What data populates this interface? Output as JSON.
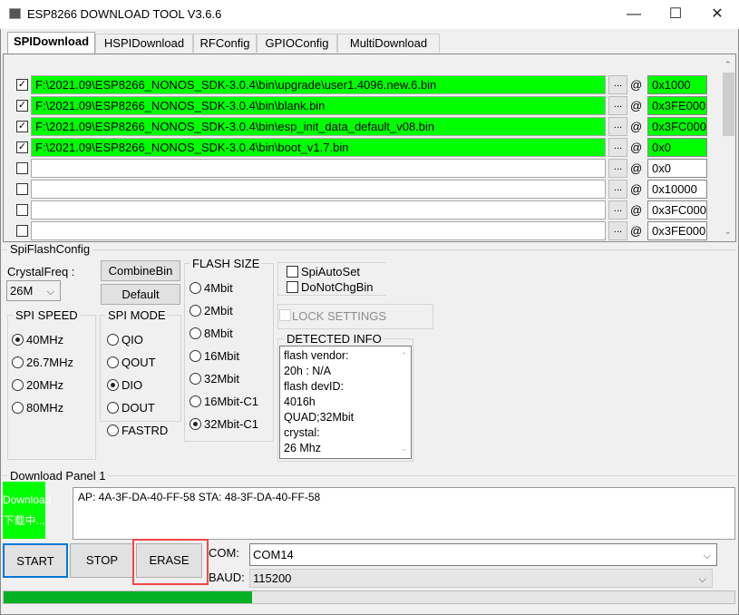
{
  "window": {
    "title": "ESP8266 DOWNLOAD TOOL V3.6.6",
    "minimize": "—",
    "maximize": "☐",
    "close": "✕"
  },
  "tabs": [
    {
      "label": "SPIDownload",
      "active": true
    },
    {
      "label": "HSPIDownload"
    },
    {
      "label": "RFConfig"
    },
    {
      "label": "GPIOConfig"
    },
    {
      "label": "MultiDownload"
    }
  ],
  "files": [
    {
      "checked": true,
      "path": "F:\\2021.09\\ESP8266_NONOS_SDK-3.0.4\\bin\\upgrade\\user1.4096.new.6.bin",
      "addr": "0x1000"
    },
    {
      "checked": true,
      "path": "F:\\2021.09\\ESP8266_NONOS_SDK-3.0.4\\bin\\blank.bin",
      "addr": "0x3FE000"
    },
    {
      "checked": true,
      "path": "F:\\2021.09\\ESP8266_NONOS_SDK-3.0.4\\bin\\esp_init_data_default_v08.bin",
      "addr": "0x3FC000"
    },
    {
      "checked": true,
      "path": "F:\\2021.09\\ESP8266_NONOS_SDK-3.0.4\\bin\\boot_v1.7.bin",
      "addr": "0x0"
    },
    {
      "checked": false,
      "path": "",
      "addr": "0x0"
    },
    {
      "checked": false,
      "path": "",
      "addr": "0x10000"
    },
    {
      "checked": false,
      "path": "",
      "addr": "0x3FC000"
    },
    {
      "checked": false,
      "path": "",
      "addr": "0x3FE000"
    }
  ],
  "browse_label": "...",
  "at_label": "@",
  "config": {
    "group_label": "SpiFlashConfig",
    "crystal_label": "CrystalFreq :",
    "crystal_value": "26M",
    "combine_label": "CombineBin",
    "default_label": "Default",
    "spi_speed": {
      "label": "SPI SPEED",
      "options": [
        "40MHz",
        "26.7MHz",
        "20MHz",
        "80MHz"
      ],
      "selected": 0
    },
    "spi_mode": {
      "label": "SPI MODE",
      "options": [
        "QIO",
        "QOUT",
        "DIO",
        "DOUT",
        "FASTRD"
      ],
      "selected": 2
    },
    "flash_size": {
      "label": "FLASH SIZE",
      "options": [
        "4Mbit",
        "2Mbit",
        "8Mbit",
        "16Mbit",
        "32Mbit",
        "16Mbit-C1",
        "32Mbit-C1"
      ],
      "selected": 6
    },
    "spi_auto_set": "SpiAutoSet",
    "do_not_chg_bin": "DoNotChgBin",
    "lock_settings": "LOCK SETTINGS",
    "detected_label": "DETECTED INFO",
    "detected_lines": [
      "flash vendor:",
      "20h : N/A",
      "flash devID:",
      "4016h",
      "QUAD;32Mbit",
      "crystal:",
      "26 Mhz"
    ]
  },
  "download": {
    "panel_label": "Download Panel 1",
    "status_line1": "Download",
    "status_line2": "下载中...",
    "status_color": "#00ff00",
    "log": "AP:  4A-3F-DA-40-FF-58  STA:  48-3F-DA-40-FF-58",
    "start": "START",
    "stop": "STOP",
    "erase": "ERASE",
    "com_label": "COM:",
    "com_value": "COM14",
    "baud_label": "BAUD:",
    "baud_value": "115200",
    "progress_percent": 34
  }
}
